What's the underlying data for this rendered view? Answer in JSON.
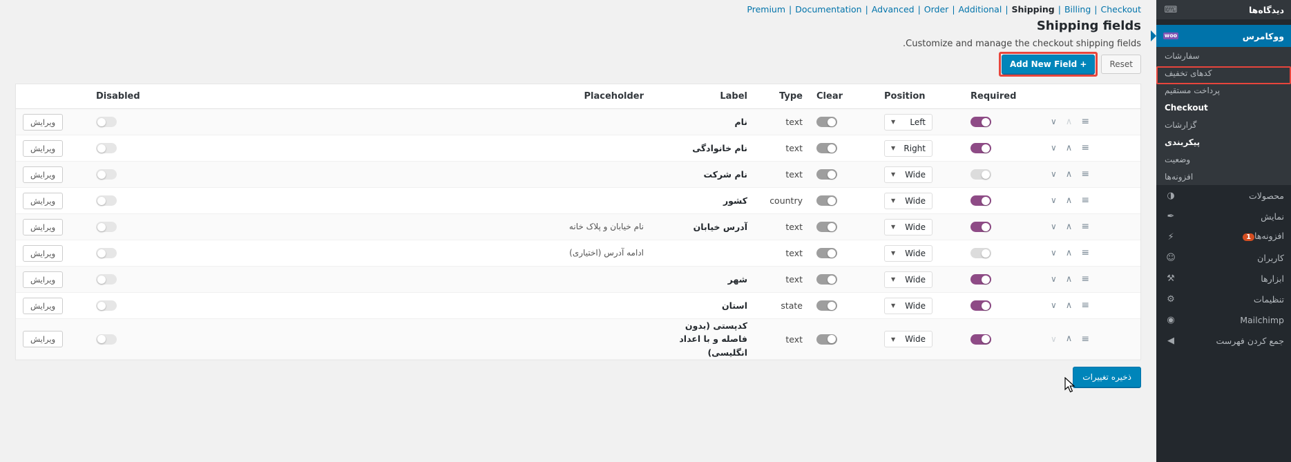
{
  "plugin_nav": {
    "links": [
      {
        "label": "Premium",
        "current": false
      },
      {
        "label": "Documentation",
        "current": false
      },
      {
        "label": "Advanced",
        "current": false
      },
      {
        "label": "Order",
        "current": false
      },
      {
        "label": "Additional",
        "current": false
      },
      {
        "label": "Shipping",
        "current": true
      },
      {
        "label": "Billing",
        "current": false
      },
      {
        "label": "Checkout",
        "current": false
      }
    ],
    "separator": "|"
  },
  "page": {
    "title": "Shipping fields",
    "subtitle": "Customize and manage the checkout shipping fields.",
    "reset_label": "Reset",
    "add_field_label": "Add New Field +",
    "save_label": "ذخیره تغییرات"
  },
  "table": {
    "headers": {
      "disabled": "Disabled",
      "placeholder": "Placeholder",
      "label": "Label",
      "type": "Type",
      "clear": "Clear",
      "position": "Position",
      "required": "Required"
    },
    "edit_label": "ویرایش",
    "rows": [
      {
        "edit": "ویرایش",
        "disabled": false,
        "placeholder": "",
        "label": "نام",
        "type": "text",
        "clear": true,
        "position": "Left",
        "required": true,
        "move_down": true,
        "move_up": false
      },
      {
        "edit": "ویرایش",
        "disabled": false,
        "placeholder": "",
        "label": "نام خانوادگی",
        "type": "text",
        "clear": true,
        "position": "Right",
        "required": true,
        "move_down": true,
        "move_up": true
      },
      {
        "edit": "ویرایش",
        "disabled": false,
        "placeholder": "",
        "label": "نام شرکت",
        "type": "text",
        "clear": true,
        "position": "Wide",
        "required": false,
        "move_down": true,
        "move_up": true
      },
      {
        "edit": "ویرایش",
        "disabled": false,
        "placeholder": "",
        "label": "کشور",
        "type": "country",
        "clear": true,
        "position": "Wide",
        "required": true,
        "move_down": true,
        "move_up": true
      },
      {
        "edit": "ویرایش",
        "disabled": false,
        "placeholder": "نام خیابان و پلاک خانه",
        "label": "آدرس خیابان",
        "type": "text",
        "clear": true,
        "position": "Wide",
        "required": true,
        "move_down": true,
        "move_up": true
      },
      {
        "edit": "ویرایش",
        "disabled": false,
        "placeholder": "ادامه آدرس (اختیاری)",
        "label": "",
        "type": "text",
        "clear": true,
        "position": "Wide",
        "required": false,
        "move_down": true,
        "move_up": true
      },
      {
        "edit": "ویرایش",
        "disabled": false,
        "placeholder": "",
        "label": "شهر",
        "type": "text",
        "clear": true,
        "position": "Wide",
        "required": true,
        "move_down": true,
        "move_up": true
      },
      {
        "edit": "ویرایش",
        "disabled": false,
        "placeholder": "",
        "label": "استان",
        "type": "state",
        "clear": true,
        "position": "Wide",
        "required": true,
        "move_down": true,
        "move_up": true
      },
      {
        "edit": "ویرایش",
        "disabled": false,
        "placeholder": "",
        "label": "کدپستی (بدون فاصله و با اعداد انگلیسی)",
        "type": "text",
        "clear": true,
        "position": "Wide",
        "required": true,
        "move_down": false,
        "move_up": true
      }
    ]
  },
  "sidebar": {
    "items": [
      {
        "label": "دیدگاه‌ها",
        "icon": "comment-icon",
        "kind": "top",
        "badge": ""
      },
      {
        "label": "ووکامرس",
        "icon": "woocommerce-icon",
        "kind": "current",
        "badge": ""
      },
      {
        "label": "سفارشات",
        "icon": "",
        "kind": "sub",
        "badge": ""
      },
      {
        "label": "کدهای تخفیف",
        "icon": "",
        "kind": "sub",
        "badge": ""
      },
      {
        "label": "پرداخت مستقیم",
        "icon": "",
        "kind": "sub",
        "badge": ""
      },
      {
        "label": "Checkout",
        "icon": "",
        "kind": "sub-current",
        "badge": ""
      },
      {
        "label": "گزارشات",
        "icon": "",
        "kind": "sub",
        "badge": ""
      },
      {
        "label": "پیکربندی",
        "icon": "",
        "kind": "sub-head",
        "badge": ""
      },
      {
        "label": "وضعیت",
        "icon": "",
        "kind": "sub",
        "badge": ""
      },
      {
        "label": "افزونه‌ها",
        "icon": "",
        "kind": "sub",
        "badge": ""
      },
      {
        "label": "محصولات",
        "icon": "products-icon",
        "kind": "main",
        "badge": ""
      },
      {
        "label": "نمایش",
        "icon": "appearance-icon",
        "kind": "main",
        "badge": ""
      },
      {
        "label": "افزونه‌ها",
        "icon": "plugins-icon",
        "kind": "main",
        "badge": "1"
      },
      {
        "label": "کاربران",
        "icon": "users-icon",
        "kind": "main",
        "badge": ""
      },
      {
        "label": "ابزارها",
        "icon": "tools-icon",
        "kind": "main",
        "badge": ""
      },
      {
        "label": "تنظیمات",
        "icon": "settings-icon",
        "kind": "main",
        "badge": ""
      },
      {
        "label": "Mailchimp",
        "icon": "mailchimp-icon",
        "kind": "main",
        "badge": ""
      },
      {
        "label": "جمع کردن فهرست",
        "icon": "collapse-icon",
        "kind": "collapse",
        "badge": ""
      }
    ]
  },
  "colors": {
    "accent": "#0085ba",
    "sidebar_bg": "#23282d",
    "highlight": "#e8453c",
    "required_on": "#8e4b86",
    "clear_on": "#9e9e9e"
  }
}
